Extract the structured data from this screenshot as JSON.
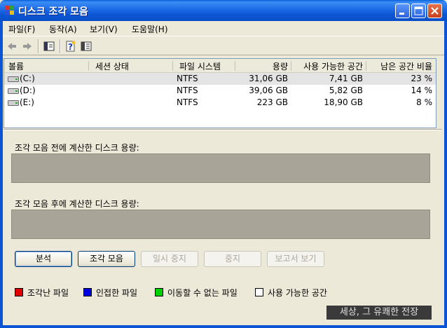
{
  "window": {
    "title": "디스크 조각 모음"
  },
  "menu": [
    "파일(F)",
    "동작(A)",
    "보기(V)",
    "도움말(H)"
  ],
  "toolbar": {
    "icons": [
      "back-arrow-icon",
      "forward-arrow-icon",
      "console-tree-icon",
      "help-icon",
      "properties-icon"
    ]
  },
  "list": {
    "columns": [
      "볼륨",
      "세션 상태",
      "파일 시스템",
      "용량",
      "사용 가능한 공간",
      "남은 공간 비율"
    ],
    "rows": [
      {
        "volume": "(C:)",
        "session": "",
        "fs": "NTFS",
        "capacity": "31,06 GB",
        "free": "7,41 GB",
        "pct": "23 %"
      },
      {
        "volume": "(D:)",
        "session": "",
        "fs": "NTFS",
        "capacity": "39,06 GB",
        "free": "5,82 GB",
        "pct": "14 %"
      },
      {
        "volume": "(E:)",
        "session": "",
        "fs": "NTFS",
        "capacity": "223 GB",
        "free": "18,90 GB",
        "pct": "8 %"
      }
    ]
  },
  "panel": {
    "before_label": "조각 모음 전에 계산한 디스크 용량:",
    "after_label": "조각 모음 후에 계산한 디스크 용량:"
  },
  "buttons": {
    "analyze": "분석",
    "defrag": "조각 모음",
    "pause": "일시 중지",
    "stop": "중지",
    "report": "보고서 보기"
  },
  "legend": [
    {
      "label": "조각난 파일",
      "color": "#e00000"
    },
    {
      "label": "인접한 파일",
      "color": "#0000e0"
    },
    {
      "label": "이동할 수 없는 파일",
      "color": "#00d000"
    },
    {
      "label": "사용 가능한 공간",
      "color": "#ffffff"
    }
  ],
  "watermark": "세상, 그 유쾌한 전장"
}
